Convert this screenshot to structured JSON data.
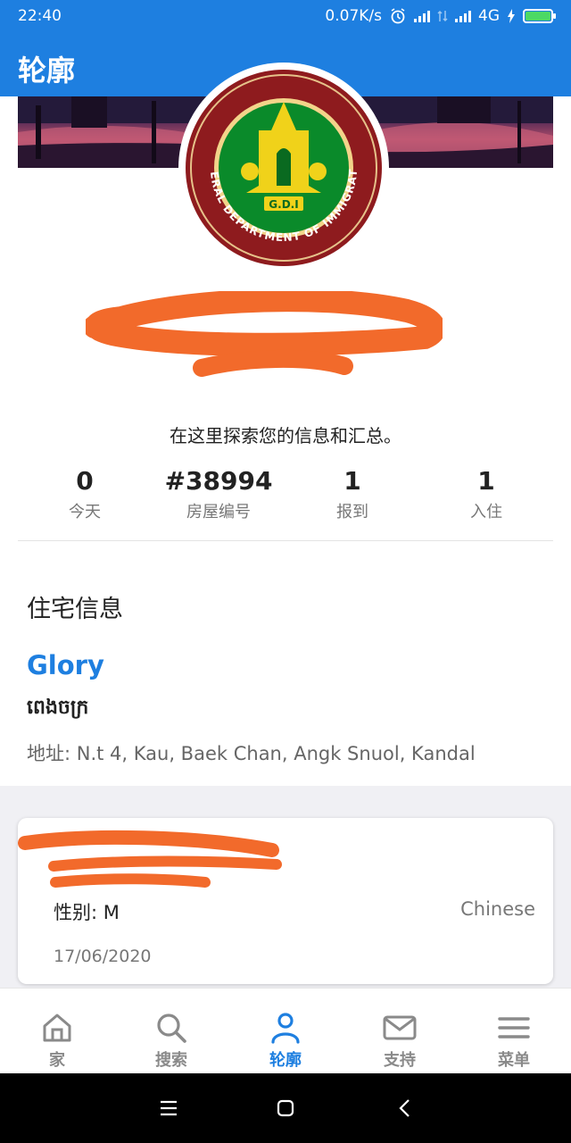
{
  "status_bar": {
    "time": "22:40",
    "net_speed": "0.07K/s",
    "network": "4G",
    "icons": [
      "alarm-icon",
      "signal-icon",
      "data-arrows-icon",
      "signal-icon",
      "charging-icon",
      "battery-icon"
    ],
    "battery_color": "#4cd964"
  },
  "app_bar": {
    "title": "轮廓"
  },
  "profile": {
    "seal_text": "GENERAL DEPARTMENT OF IMMIGRATION",
    "seal_abbr": "G.D.I",
    "tagline": "在这里探索您的信息和汇总。"
  },
  "stats": [
    {
      "value": "0",
      "label": "今天"
    },
    {
      "value": "#38994",
      "label": "房屋编号"
    },
    {
      "value": "1",
      "label": "报到"
    },
    {
      "value": "1",
      "label": "入住"
    }
  ],
  "residence": {
    "section_title": "住宅信息",
    "name": "Glory",
    "khmer_name": "ពេងចក្រ",
    "address": "地址: N.t 4, Kau, Baek Chan, Angk Snuol, Kandal"
  },
  "guest_card": {
    "gender": "性别: M",
    "nationality": "Chinese",
    "date": "17/06/2020"
  },
  "bottom_nav": [
    {
      "label": "家",
      "icon": "home-icon",
      "active": false
    },
    {
      "label": "搜索",
      "icon": "search-icon",
      "active": false
    },
    {
      "label": "轮廓",
      "icon": "user-icon",
      "active": true
    },
    {
      "label": "支持",
      "icon": "mail-icon",
      "active": false
    },
    {
      "label": "菜单",
      "icon": "menu-icon",
      "active": false
    }
  ],
  "colors": {
    "primary": "#1e7fe0",
    "redaction": "#f26a2b",
    "seal_red": "#8e1b1e",
    "seal_green": "#0a8a2a",
    "seal_gold": "#f0d21a"
  }
}
